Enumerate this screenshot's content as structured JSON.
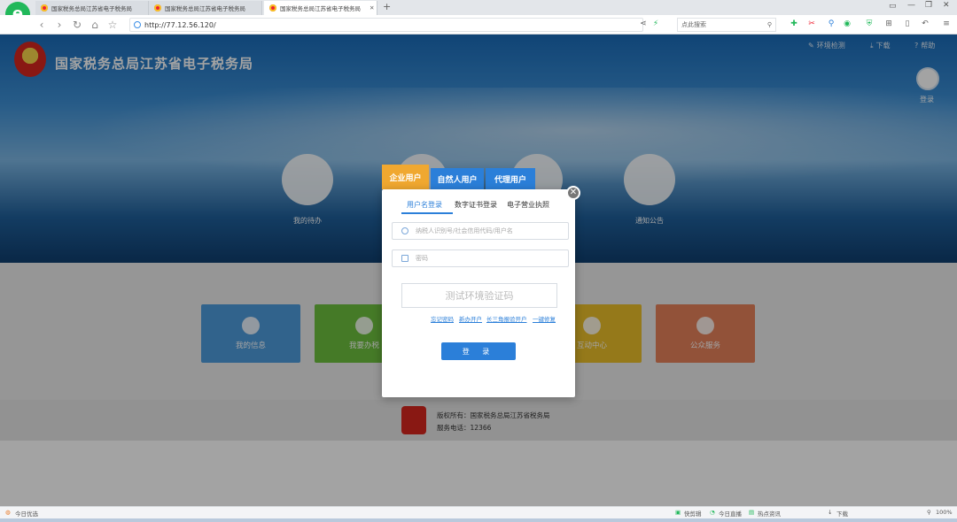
{
  "browser": {
    "tabs": [
      {
        "title": "国家税务总局江苏省电子税务局",
        "active": false
      },
      {
        "title": "国家税务总局江苏省电子税务局",
        "active": false
      },
      {
        "title": "国家税务总局江苏省电子税务局",
        "active": true
      }
    ],
    "close_tab": "✕",
    "new_tab": "+",
    "url": "http://77.12.56.120/",
    "search_placeholder": "点此搜索"
  },
  "site": {
    "title": "国家税务总局江苏省电子税务局",
    "nav": {
      "env_check": "环境检测",
      "download": "下载",
      "help": "帮助"
    },
    "login_label": "登录",
    "circles": [
      {
        "label": "我的待办"
      },
      {
        "label": ""
      },
      {
        "label": ""
      },
      {
        "label": "通知公告"
      }
    ],
    "tiles": [
      {
        "label": "我的信息",
        "color": "#4e9bdb"
      },
      {
        "label": "我要办税",
        "color": "#6cbf3d"
      },
      {
        "label": "互动中心",
        "color": "#e9bd29"
      },
      {
        "label": "公众服务",
        "color": "#e5805a"
      }
    ],
    "footer": {
      "copyright": "版权所有：国家税务总局江苏省税务局",
      "phone": "服务电话：12366"
    }
  },
  "modal": {
    "user_tabs": [
      {
        "label": "企业用户",
        "color": "#f0a830"
      },
      {
        "label": "自然人用户",
        "color": "#2b7fd9"
      },
      {
        "label": "代理用户",
        "color": "#2b7fd9"
      }
    ],
    "sub_tabs": [
      "用户名登录",
      "数字证书登录",
      "电子营业执照"
    ],
    "username_placeholder": "纳税人识别号/社会信用代码/用户名",
    "password_placeholder": "密码",
    "captcha_text": "测试环境验证码",
    "links": [
      "忘记密码",
      "新办开户",
      "长三角报验开户",
      "一键修复"
    ],
    "login_button": "登 录",
    "close": "✕"
  },
  "statusbar": {
    "left": "今日优选",
    "items": [
      "快剪辑",
      "今日直播",
      "热点资讯",
      "下载"
    ],
    "zoom": "100%"
  }
}
